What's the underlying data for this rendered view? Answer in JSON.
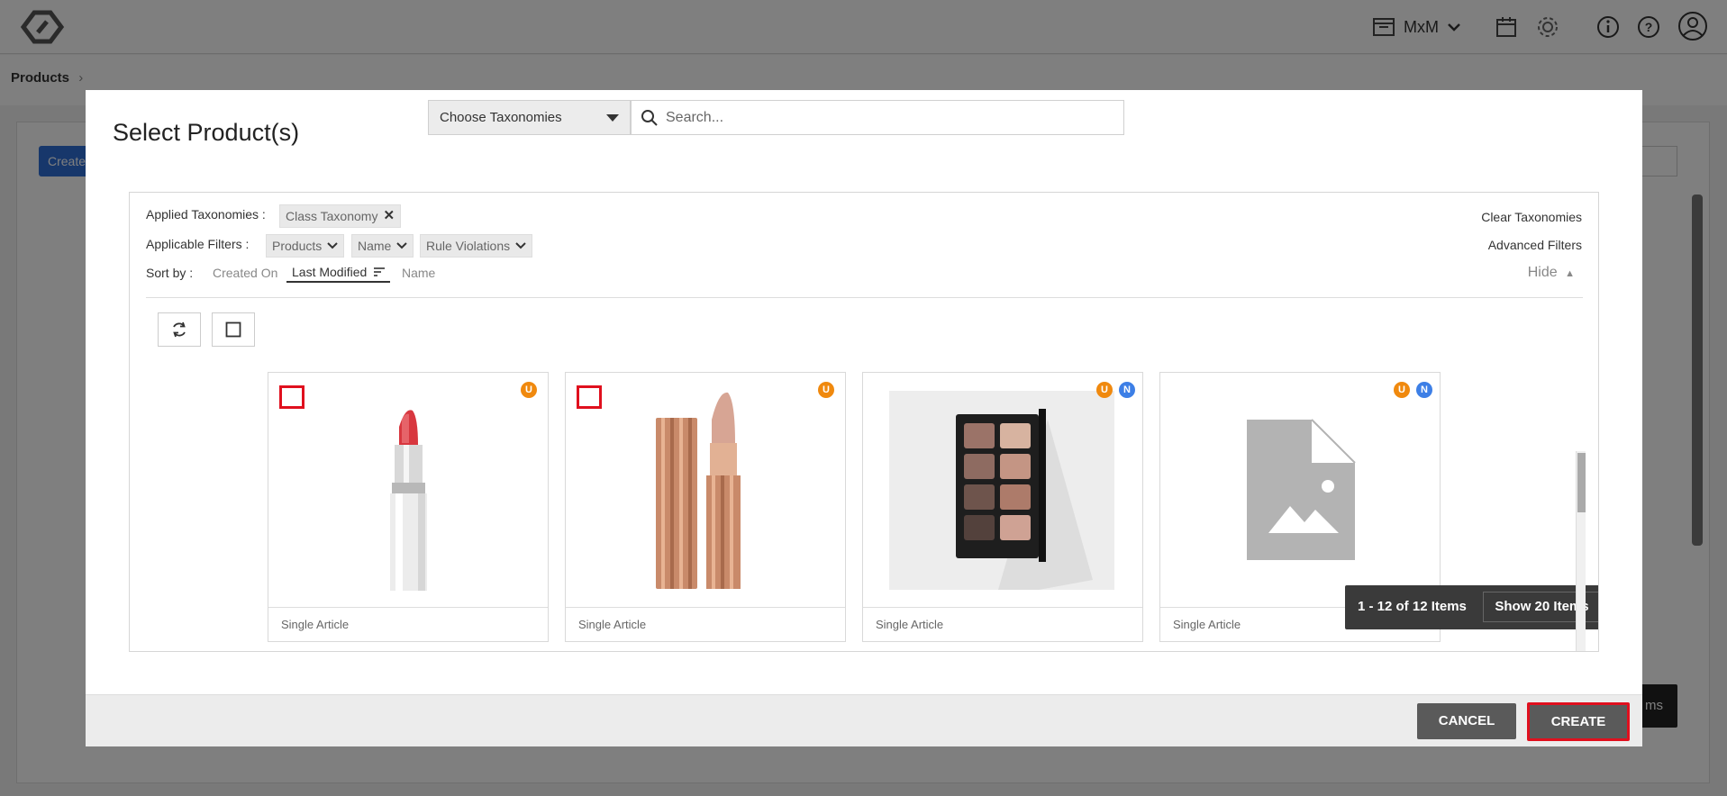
{
  "header": {
    "store_label": "MxM"
  },
  "breadcrumb": {
    "items": [
      "Products"
    ]
  },
  "background": {
    "create_button": "Create",
    "footer_button": "ms"
  },
  "modal": {
    "title": "Select Product(s)",
    "taxonomy_select": "Choose Taxonomies",
    "search_placeholder": "Search...",
    "applied_taxonomies_label": "Applied Taxonomies :",
    "applied_taxonomies": [
      "Class Taxonomy"
    ],
    "applicable_filters_label": "Applicable Filters :",
    "filters": [
      "Products",
      "Name",
      "Rule Violations"
    ],
    "sort_label": "Sort by :",
    "sort_options": [
      "Created On",
      "Last Modified",
      "Name"
    ],
    "clear_taxonomies": "Clear Taxonomies",
    "advanced_filters": "Advanced Filters",
    "hide_label": "Hide",
    "cards": [
      {
        "type": "Single Article",
        "badges": [
          "U"
        ],
        "image": "red-lipstick"
      },
      {
        "type": "Single Article",
        "badges": [
          "U"
        ],
        "image": "nude-lipstick"
      },
      {
        "type": "Single Article",
        "badges": [
          "U",
          "N"
        ],
        "image": "eyeshadow-palette"
      },
      {
        "type": "Single Article",
        "badges": [
          "U",
          "N"
        ],
        "image": "placeholder-image"
      }
    ],
    "pager": {
      "count_text": "1 - 12 of 12 Items",
      "show_button": "Show 20 Items"
    },
    "cancel_button": "CANCEL",
    "create_button": "CREATE"
  },
  "colors": {
    "highlight": "#e0101e",
    "badge_u": "#f0890e",
    "badge_n": "#3d7fe6",
    "button_dark": "#5a5a5a"
  }
}
